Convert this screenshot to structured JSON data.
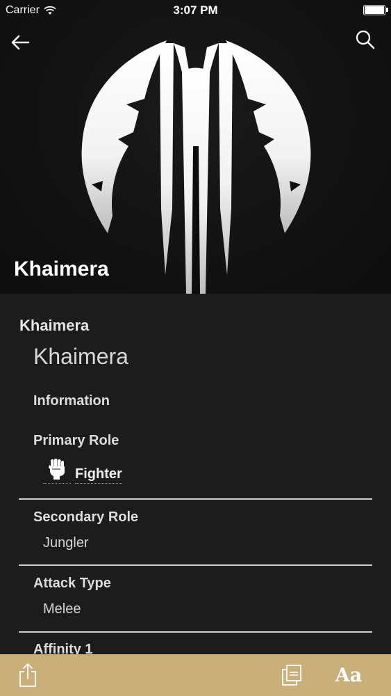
{
  "status_bar": {
    "carrier": "Carrier",
    "time": "3:07 PM"
  },
  "nav": {
    "back_icon": "arrow-left-icon",
    "search_icon": "search-icon"
  },
  "hero": {
    "title": "Khaimera"
  },
  "article": {
    "heading": "Khaimera",
    "subtitle": "Khaimera",
    "info_heading": "Information",
    "fields": {
      "primary_role_label": "Primary Role",
      "primary_role_value": "Fighter",
      "secondary_role_label": "Secondary Role",
      "secondary_role_value": "Jungler",
      "attack_type_label": "Attack Type",
      "attack_type_value": "Melee",
      "affinity_label": "Affinity 1"
    }
  },
  "toolbar": {
    "share_icon": "share-icon",
    "tabs_icon": "tabs-icon",
    "font_label": "Aa"
  },
  "colors": {
    "toolbar": "#c9b07a",
    "background": "#1c1c1c",
    "hero_background": "#0d0d0d"
  }
}
